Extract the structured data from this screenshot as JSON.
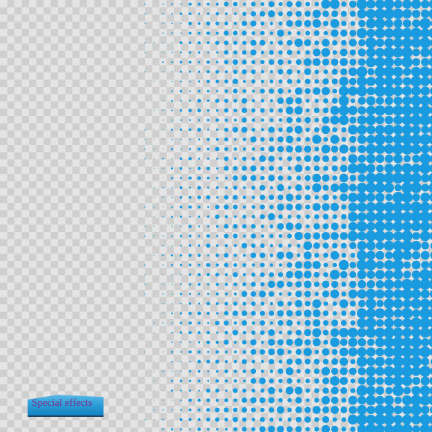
{
  "artwork": {
    "type": "halftone-dot-gradient",
    "description": "Blue halftone dots fading from dense (right) to sparse (left) over a transparency checkerboard",
    "dot_color": "#1a9be0",
    "checker_light": "#e4e4e4",
    "checker_dark": "#cfcfcf",
    "gradient_direction": "left-to-right"
  },
  "badge": {
    "label": "Special effects",
    "label_color": "#7a2e8c",
    "fill_color": "#2e9fd8"
  }
}
